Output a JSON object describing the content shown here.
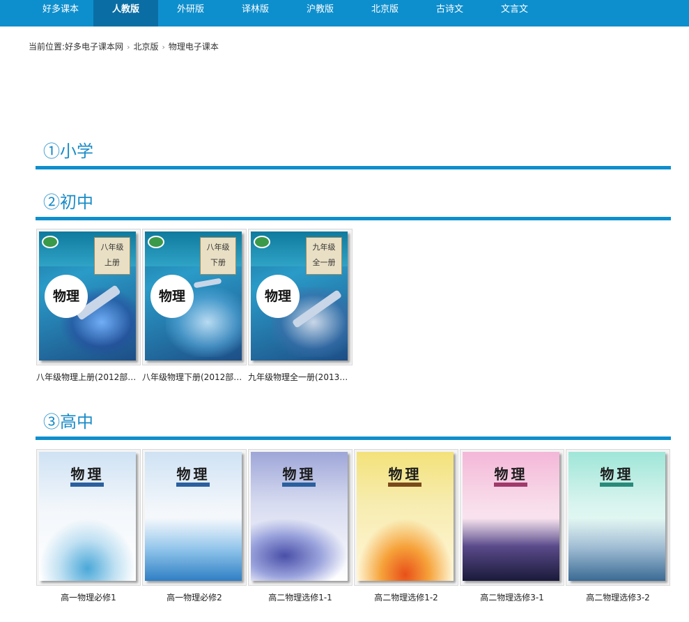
{
  "nav": {
    "items": [
      {
        "label": "好多课本",
        "active": false
      },
      {
        "label": "人教版",
        "active": true
      },
      {
        "label": "外研版",
        "active": false
      },
      {
        "label": "译林版",
        "active": false
      },
      {
        "label": "沪教版",
        "active": false
      },
      {
        "label": "北京版",
        "active": false
      },
      {
        "label": "古诗文",
        "active": false
      },
      {
        "label": "文言文",
        "active": false
      }
    ]
  },
  "breadcrumb": {
    "prefix": "当前位置:",
    "home": "好多电子课本网",
    "level1": "北京版",
    "current": "物理电子课本"
  },
  "sections": {
    "primary": {
      "title": "①小学"
    },
    "junior": {
      "title": "②初中",
      "books": [
        {
          "caption": "八年级物理上册(2012部…",
          "grade": "八年级",
          "volume": "上册",
          "cover_title": "物理"
        },
        {
          "caption": "八年级物理下册(2012部…",
          "grade": "八年级",
          "volume": "下册",
          "cover_title": "物理"
        },
        {
          "caption": "九年级物理全一册(2013…",
          "grade": "九年级",
          "volume": "全一册",
          "cover_title": "物理"
        }
      ]
    },
    "senior": {
      "title": "③高中",
      "books": [
        {
          "caption": "高一物理必修1",
          "cover_title": "物理"
        },
        {
          "caption": "高一物理必修2",
          "cover_title": "物理"
        },
        {
          "caption": "高二物理选修1-1",
          "cover_title": "物理"
        },
        {
          "caption": "高二物理选修1-2",
          "cover_title": "物理"
        },
        {
          "caption": "高二物理选修3-1",
          "cover_title": "物理"
        },
        {
          "caption": "高二物理选修3-2",
          "cover_title": "物理"
        }
      ]
    }
  },
  "colors": {
    "brand": "#0e8fcd",
    "active_tab": "#0a6ea4",
    "section_title": "#1a8cc7"
  }
}
